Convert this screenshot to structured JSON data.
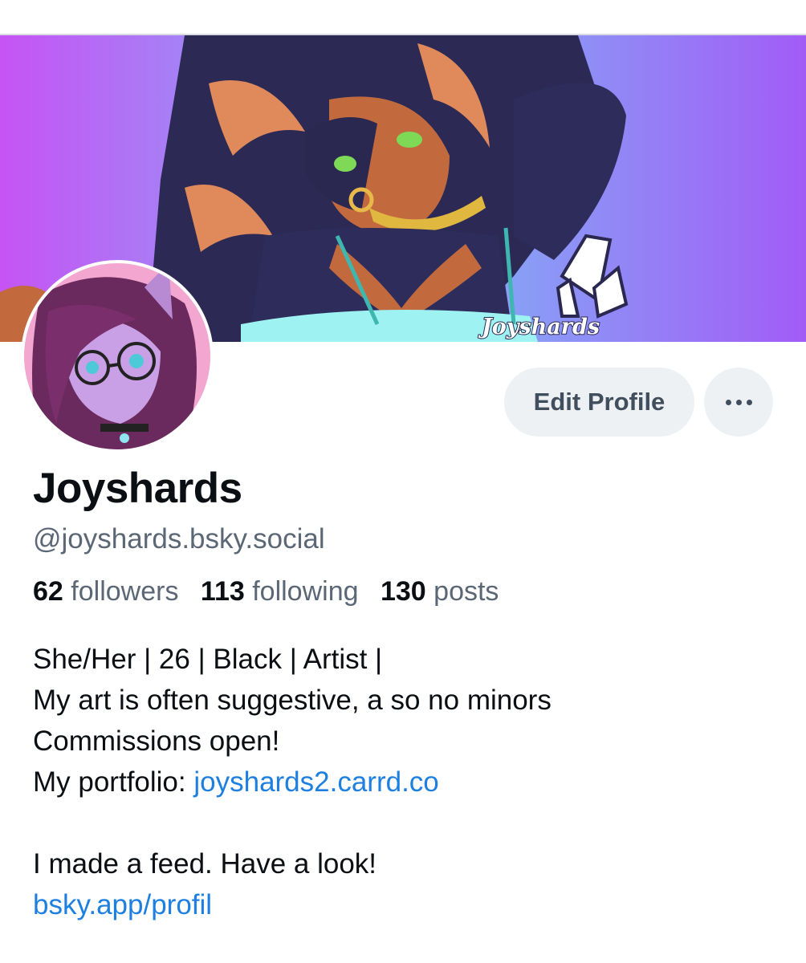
{
  "banner": {
    "watermark": "Joyshards"
  },
  "profile": {
    "display_name": "Joyshards",
    "handle": "@joyshards.bsky.social"
  },
  "actions": {
    "edit_profile_label": "Edit Profile",
    "more_icon": "more-horizontal-icon"
  },
  "stats": [
    {
      "count": "62",
      "label": "followers"
    },
    {
      "count": "113",
      "label": "following"
    },
    {
      "count": "130",
      "label": "posts"
    }
  ],
  "bio": {
    "line1": "She/Her | 26 | Black | Artist |",
    "line2": "My art is often suggestive, a so no minors",
    "line3": "Commissions open!",
    "line4_prefix": "My portfolio: ",
    "portfolio_link": "joyshards2.carrd.co",
    "line5": "I made a feed. Have a look!",
    "feed_link": "bsky.app/profil"
  },
  "colors": {
    "banner_gradient_left": "#c653f5",
    "banner_gradient_center": "#7fb8f6",
    "banner_gradient_right": "#a25cf6",
    "link": "#1d7fe0",
    "secondary_text": "#5b6775",
    "button_bg": "#eef1f4"
  }
}
